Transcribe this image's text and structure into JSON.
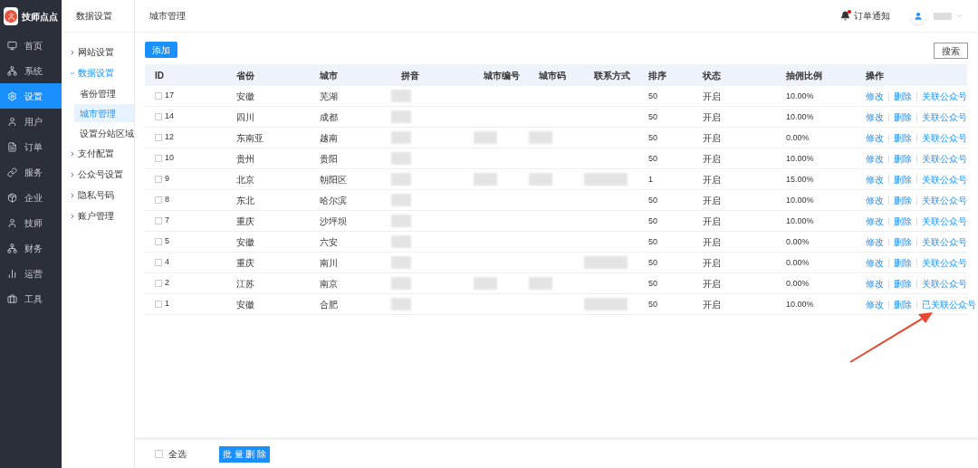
{
  "app": {
    "name": "技师点点"
  },
  "nav": [
    {
      "label": "首页",
      "selected": false
    },
    {
      "label": "系统",
      "selected": false
    },
    {
      "label": "设置",
      "selected": true
    },
    {
      "label": "用户",
      "selected": false
    },
    {
      "label": "订单",
      "selected": false
    },
    {
      "label": "服务",
      "selected": false
    },
    {
      "label": "企业",
      "selected": false
    },
    {
      "label": "技师",
      "selected": false
    },
    {
      "label": "财务",
      "selected": false
    },
    {
      "label": "运营",
      "selected": false
    },
    {
      "label": "工具",
      "selected": false
    }
  ],
  "submenu": {
    "title": "数据设置",
    "items": [
      {
        "label": "网站设置",
        "expanded": false
      },
      {
        "label": "数据设置",
        "expanded": true,
        "children": [
          {
            "label": "省份管理",
            "selected": false
          },
          {
            "label": "城市管理",
            "selected": true
          },
          {
            "label": "设置分站区域",
            "selected": false
          }
        ]
      },
      {
        "label": "支付配置",
        "expanded": false
      },
      {
        "label": "公众号设置",
        "expanded": false
      },
      {
        "label": "隐私号码",
        "expanded": false
      },
      {
        "label": "账户管理",
        "expanded": false
      }
    ]
  },
  "header": {
    "breadcrumb": "城市管理",
    "notification": "订单通知",
    "has_unread": true
  },
  "toolbar": {
    "add": "添加",
    "search": "搜索"
  },
  "table": {
    "columns": [
      "ID",
      "省份",
      "城市",
      "拼音",
      "城市编号",
      "城市码",
      "联系方式",
      "排序",
      "状态",
      "抽佣比例",
      "操作"
    ],
    "rows": [
      {
        "checked": false,
        "id": "17",
        "province": "安徽",
        "city": "芜湖",
        "pinyin_blurred": true,
        "number_blurred": false,
        "code_blurred": false,
        "contact_blurred": false,
        "sort": "50",
        "status": "开启",
        "rate": "10.00%",
        "actions": [
          "修改",
          "删除",
          "关联公众号"
        ]
      },
      {
        "checked": false,
        "id": "14",
        "province": "四川",
        "city": "成都",
        "pinyin_blurred": true,
        "number_blurred": false,
        "code_blurred": false,
        "contact_blurred": false,
        "sort": "50",
        "status": "开启",
        "rate": "10.00%",
        "actions": [
          "修改",
          "删除",
          "关联公众号"
        ]
      },
      {
        "checked": false,
        "id": "12",
        "province": "东南亚",
        "city": "越南",
        "pinyin_blurred": true,
        "number_blurred": true,
        "code_blurred": true,
        "contact_blurred": false,
        "sort": "50",
        "status": "开启",
        "rate": "0.00%",
        "actions": [
          "修改",
          "删除",
          "关联公众号"
        ]
      },
      {
        "checked": false,
        "id": "10",
        "province": "贵州",
        "city": "贵阳",
        "pinyin_blurred": true,
        "number_blurred": false,
        "code_blurred": false,
        "contact_blurred": false,
        "sort": "50",
        "status": "开启",
        "rate": "10.00%",
        "actions": [
          "修改",
          "删除",
          "关联公众号"
        ]
      },
      {
        "checked": false,
        "id": "9",
        "province": "北京",
        "city": "朝阳区",
        "pinyin_blurred": true,
        "number_blurred": true,
        "code_blurred": true,
        "contact_blurred": true,
        "sort": "1",
        "status": "开启",
        "rate": "15.00%",
        "actions": [
          "修改",
          "删除",
          "关联公众号"
        ]
      },
      {
        "checked": false,
        "id": "8",
        "province": "东北",
        "city": "哈尔滨",
        "pinyin_blurred": true,
        "number_blurred": false,
        "code_blurred": false,
        "contact_blurred": false,
        "sort": "50",
        "status": "开启",
        "rate": "10.00%",
        "actions": [
          "修改",
          "删除",
          "关联公众号"
        ]
      },
      {
        "checked": false,
        "id": "7",
        "province": "重庆",
        "city": "沙坪坝",
        "pinyin_blurred": true,
        "number_blurred": false,
        "code_blurred": false,
        "contact_blurred": false,
        "sort": "50",
        "status": "开启",
        "rate": "10.00%",
        "actions": [
          "修改",
          "删除",
          "关联公众号"
        ]
      },
      {
        "checked": false,
        "id": "5",
        "province": "安徽",
        "city": "六安",
        "pinyin_blurred": true,
        "number_blurred": false,
        "code_blurred": false,
        "contact_blurred": false,
        "sort": "50",
        "status": "开启",
        "rate": "0.00%",
        "actions": [
          "修改",
          "删除",
          "关联公众号"
        ]
      },
      {
        "checked": false,
        "id": "4",
        "province": "重庆",
        "city": "南川",
        "pinyin_blurred": true,
        "number_blurred": false,
        "code_blurred": false,
        "contact_blurred": true,
        "sort": "50",
        "status": "开启",
        "rate": "0.00%",
        "actions": [
          "修改",
          "删除",
          "关联公众号"
        ]
      },
      {
        "checked": false,
        "id": "2",
        "province": "江苏",
        "city": "南京",
        "pinyin_blurred": true,
        "number_blurred": true,
        "code_blurred": true,
        "contact_blurred": false,
        "sort": "50",
        "status": "开启",
        "rate": "0.00%",
        "actions": [
          "修改",
          "删除",
          "关联公众号"
        ]
      },
      {
        "checked": false,
        "id": "1",
        "province": "安徽",
        "city": "合肥",
        "pinyin_blurred": true,
        "number_blurred": false,
        "code_blurred": false,
        "contact_blurred": true,
        "sort": "50",
        "status": "开启",
        "rate": "10.00%",
        "actions": [
          "修改",
          "删除",
          "已关联公众号"
        ]
      }
    ]
  },
  "footer": {
    "select_all": "全选",
    "select_all_checked": false,
    "batch_delete": "批 量 删 除"
  },
  "annotation": {
    "arrow": true
  }
}
